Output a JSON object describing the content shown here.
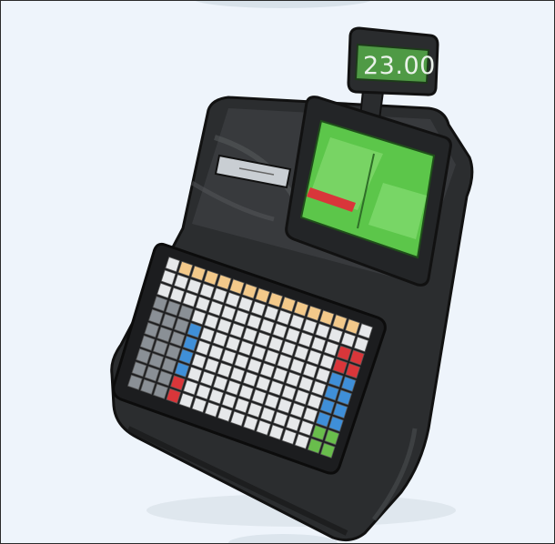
{
  "illustration": {
    "subject": "cash-register",
    "customer_display_value": "23.00",
    "colors": {
      "background": "#eef4fb",
      "body": "#2b2d2f",
      "screen": "#5cc64a",
      "key_light": "#e6e8ea",
      "key_orange": "#f3c98a",
      "key_blue": "#3f8fd8",
      "key_red": "#d9363a",
      "key_gray": "#8a9096",
      "key_green": "#69bd4c"
    }
  }
}
